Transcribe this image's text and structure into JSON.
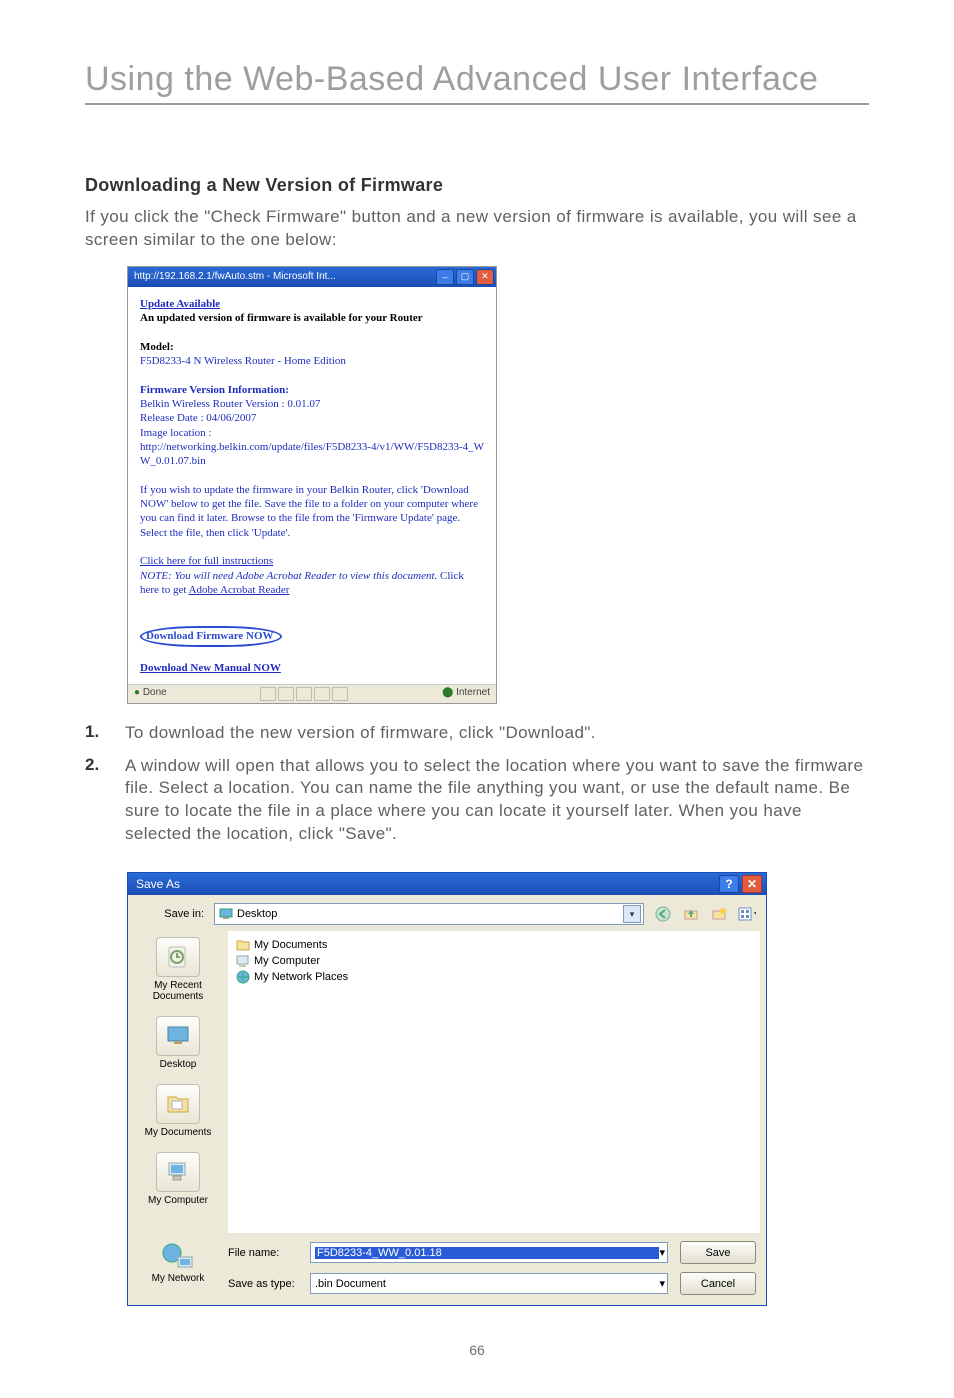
{
  "header": {
    "title": "Using the Web-Based Advanced User Interface"
  },
  "section": {
    "heading": "Downloading a New Version of Firmware",
    "intro": "If you click the \"Check Firmware\" button and a new version of firmware is available, you will see a screen similar to the one below:"
  },
  "popup1": {
    "titlebar": "http://192.168.2.1/fwAuto.stm - Microsoft Int...",
    "update_available": "Update Available",
    "update_line2": "An updated version of firmware is available for your Router",
    "model_label": "Model:",
    "model_line": "F5D8233-4 N Wireless Router - Home Edition",
    "fvi_head": "Firmware Version Information:",
    "fvi_version": "Belkin Wireless Router Version : 0.01.07",
    "fvi_release": "Release Date : 04/06/2007",
    "fvi_imgloc": "Image location :",
    "fvi_url": "http://networking.belkin.com/update/files/F5D8233-4/v1/WW/F5D8233-4_WW_0.01.07.bin",
    "guide": "If you wish to update the firmware in your Belkin Router, click 'Download NOW' below to get the file. Save the file to a folder on your computer where you can find it later. Browse to the file from the 'Firmware Update' page. Select the file, then click 'Update'.",
    "click_here": "Click here for full instructions",
    "note": "NOTE: You will need Adobe Acrobat Reader to view this document.",
    "get_adobe_pre": " Click here to get ",
    "get_adobe_label": "Adobe Acrobat Reader",
    "download_fw": "Download Firmware NOW",
    "download_manual": "Download New Manual NOW",
    "status_done": "Done",
    "status_zone": "Internet"
  },
  "steps": {
    "s1": "To download the new version of firmware, click \"Download\".",
    "s2": "A window will open that allows you to select the location where you want to save the firmware file. Select a location. You can name the file anything you want, or use the default name. Be sure to locate the file in a place where you can locate it yourself later. When you have selected the location, click \"Save\"."
  },
  "saveas": {
    "title": "Save As",
    "savein_label": "Save in:",
    "savein_value": "Desktop",
    "file_items": [
      "My Documents",
      "My Computer",
      "My Network Places"
    ],
    "places": [
      "My Recent Documents",
      "Desktop",
      "My Documents",
      "My Computer",
      "My Network"
    ],
    "filename_label": "File name:",
    "filename_value": "F5D8233-4_WW_0.01.18",
    "savetype_label": "Save as type:",
    "savetype_value": ".bin Document",
    "save_btn": "Save",
    "cancel_btn": "Cancel"
  },
  "pagenum": "66"
}
